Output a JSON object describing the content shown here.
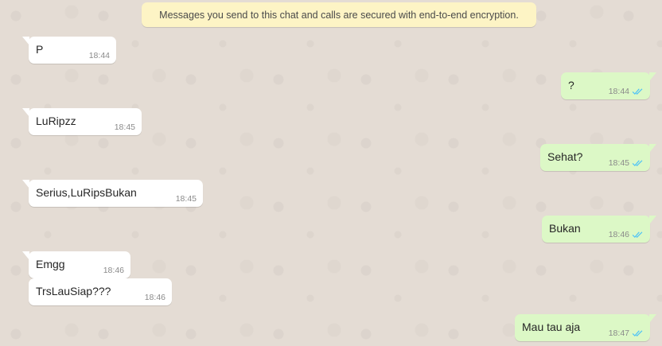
{
  "colors": {
    "incoming_bubble": "#ffffff",
    "outgoing_bubble": "#dcf8c6",
    "notice_bg": "#fdf4c5",
    "read_ticks": "#4fc3f7",
    "wallpaper": "#e5ddd5"
  },
  "encryption_notice": "Messages you send to this chat and calls are secured with end-to-end encryption.",
  "messages": [
    {
      "direction": "in",
      "text": "P",
      "time": "18:44"
    },
    {
      "direction": "out",
      "text": "?",
      "time": "18:44",
      "status_icon": "double-check-read-icon"
    },
    {
      "direction": "in",
      "text": "LuRipzz",
      "time": "18:45"
    },
    {
      "direction": "out",
      "text": "Sehat?",
      "time": "18:45",
      "status_icon": "double-check-read-icon"
    },
    {
      "direction": "in",
      "text": "Serius,LuRipsBukan",
      "time": "18:45"
    },
    {
      "direction": "out",
      "text": "Bukan",
      "time": "18:46",
      "status_icon": "double-check-read-icon"
    },
    {
      "direction": "in",
      "text": "Emgg",
      "time": "18:46"
    },
    {
      "direction": "in",
      "text": "TrsLauSiap???",
      "time": "18:46"
    },
    {
      "direction": "out",
      "text": "Mau tau aja",
      "time": "18:47",
      "status_icon": "double-check-read-icon"
    }
  ]
}
